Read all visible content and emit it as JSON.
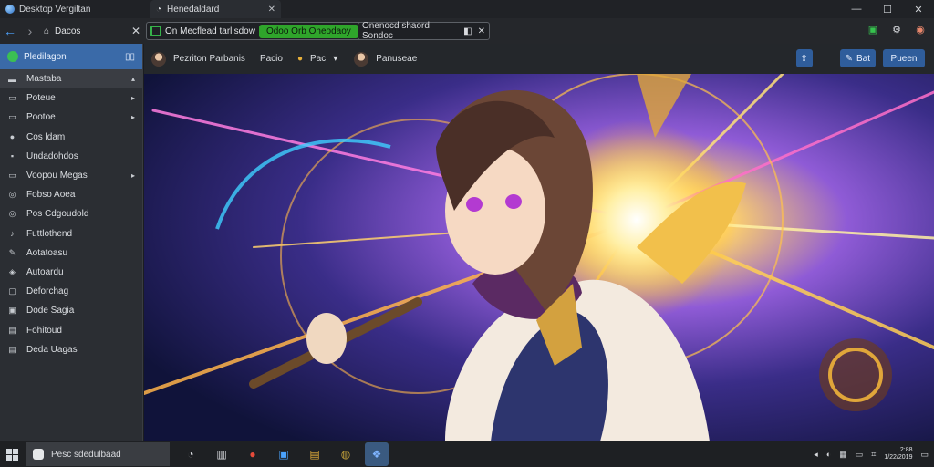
{
  "window": {
    "title": "Desktop Vergiltan",
    "tab_title": "Henedaldard",
    "controls": {
      "minimize": "—",
      "maximize": "☐",
      "close": "✕"
    }
  },
  "toolbar": {
    "home_label": "Dacos",
    "address_text": "On Mecflead tarlisdow",
    "chip_label": "Odoo Orb Oheodaoy",
    "address2_text": "Onenocd shaord Sondoc"
  },
  "sidebar": {
    "header": "Pledilagon",
    "items": [
      {
        "label": "Mastaba",
        "icon": "▬",
        "chev": "▴"
      },
      {
        "label": "Poteue",
        "icon": "▭",
        "chev": "▸"
      },
      {
        "label": "Pootoe",
        "icon": "▭",
        "chev": "▸"
      },
      {
        "label": "Cos ldam",
        "icon": "●",
        "chev": ""
      },
      {
        "label": "Undadohdos",
        "icon": "▪",
        "chev": ""
      },
      {
        "label": "Voopou Megas",
        "icon": "▭",
        "chev": "▸"
      },
      {
        "label": "Fobso Aoea",
        "icon": "◎",
        "chev": ""
      },
      {
        "label": "Pos Cdgoudold",
        "icon": "◎",
        "chev": ""
      },
      {
        "label": "Futtlothend",
        "icon": "♪",
        "chev": ""
      },
      {
        "label": "Aotatoasu",
        "icon": "✎",
        "chev": ""
      },
      {
        "label": "Autoardu",
        "icon": "◈",
        "chev": ""
      },
      {
        "label": "Deforchag",
        "icon": "▢",
        "chev": ""
      },
      {
        "label": "Dode Sagia",
        "icon": "▣",
        "chev": ""
      },
      {
        "label": "Fohitoud",
        "icon": "▤",
        "chev": ""
      },
      {
        "label": "Deda Uagas",
        "icon": "▤",
        "chev": ""
      }
    ]
  },
  "subbar": {
    "crumb1": "Pezriton Parbanis",
    "crumb2": "Pacio",
    "crumb3": "Pac",
    "crumb4": "Panuseae",
    "btn1": "Bat",
    "btn2": "Pueen"
  },
  "taskbar": {
    "search": "Pesc sdedulbaad",
    "clock_time": "2:88",
    "clock_date": "1/22/2019"
  }
}
